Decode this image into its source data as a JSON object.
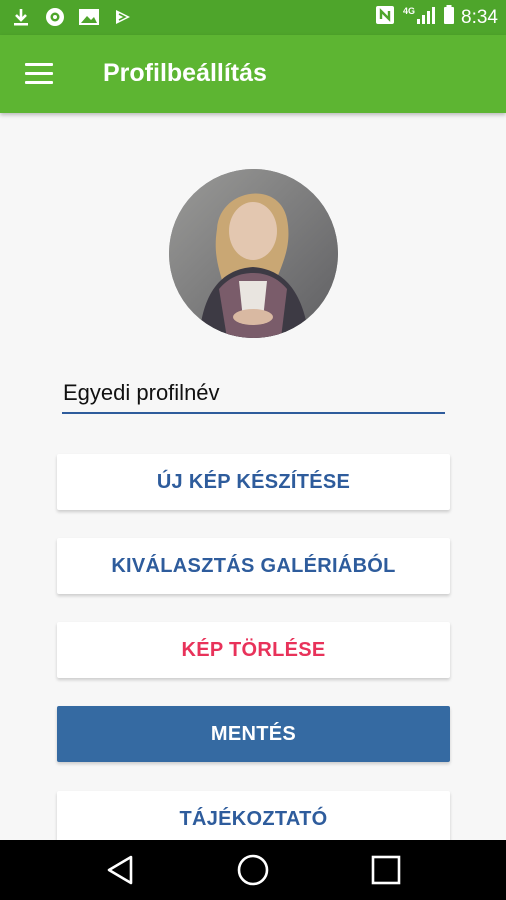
{
  "status_bar": {
    "time": "8:34",
    "left_icons": [
      "download-icon",
      "sync-icon",
      "image-icon",
      "app-notification-icon"
    ],
    "right_icons": [
      "nfc-icon",
      "signal-4g-icon",
      "battery-icon"
    ]
  },
  "app_bar": {
    "title": "Profilbeállítás",
    "menu_icon": "menu-icon"
  },
  "profile": {
    "name_value": "Egyedi profilnév"
  },
  "buttons": {
    "take_photo": "ÚJ KÉP KÉSZÍTÉSE",
    "choose_gallery": "KIVÁLASZTÁS GALÉRIÁBÓL",
    "delete_photo": "KÉP TÖRLÉSE",
    "save": "MENTÉS",
    "info": "TÁJÉKOZTATÓ"
  },
  "colors": {
    "app_bar": "#5db532",
    "status_bar": "#4ea52b",
    "accent_blue": "#2e5c9c",
    "danger": "#e8325a",
    "primary_button": "#356aa2"
  },
  "nav_bar": {
    "icons": [
      "back-icon",
      "home-icon",
      "recents-icon"
    ]
  }
}
